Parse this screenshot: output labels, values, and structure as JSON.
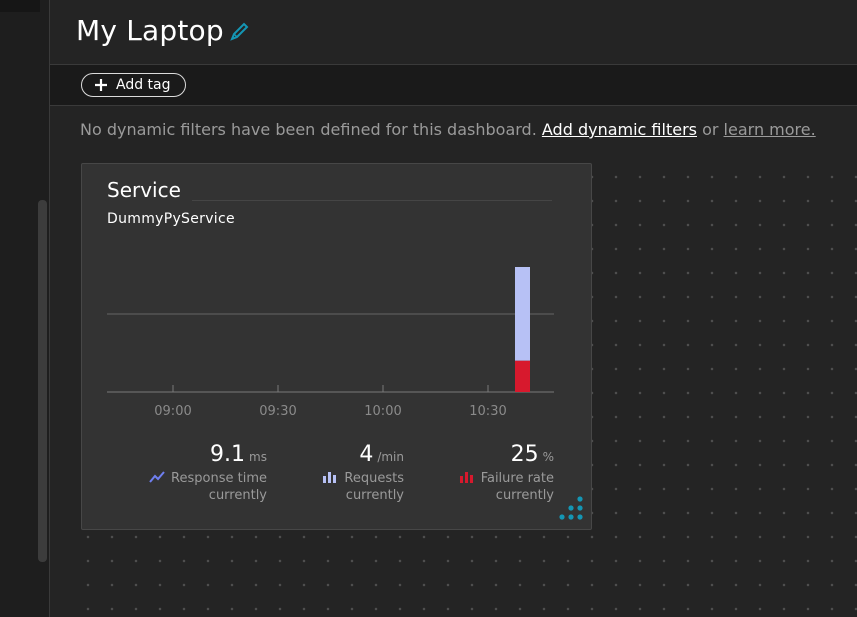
{
  "page": {
    "title": "My Laptop"
  },
  "tags": {
    "add_label": "Add tag"
  },
  "filters": {
    "notice_prefix": "No dynamic filters have been defined for this dashboard.",
    "add_link": "Add dynamic filters",
    "or_text": "or",
    "learn_link": "learn more."
  },
  "tile": {
    "title": "Service",
    "service_name": "DummyPyService",
    "metrics": [
      {
        "value": "9.1",
        "unit": "ms",
        "label": "Response time",
        "sub": "currently",
        "icon": "line-chart-icon"
      },
      {
        "value": "4",
        "unit": "/min",
        "label": "Requests",
        "sub": "currently",
        "icon": "bar-chart-icon"
      },
      {
        "value": "25",
        "unit": "%",
        "label": "Failure rate",
        "sub": "currently",
        "icon": "bar-chart-icon"
      }
    ]
  },
  "colors": {
    "accent": "#1496b4",
    "requests_bar": "#b7c1f5",
    "failure_bar": "#d7192d",
    "response_icon": "#6f7ff0",
    "requests_icon": "#b7c1f5",
    "failure_icon": "#d7192d"
  },
  "chart_data": {
    "type": "bar",
    "x_ticks": [
      "09:00",
      "09:30",
      "10:00",
      "10:30"
    ],
    "series": [
      {
        "name": "Requests",
        "x": "10:33",
        "value": 4
      },
      {
        "name": "Failure rate",
        "x": "10:33",
        "value": 1
      }
    ],
    "grid": true
  }
}
